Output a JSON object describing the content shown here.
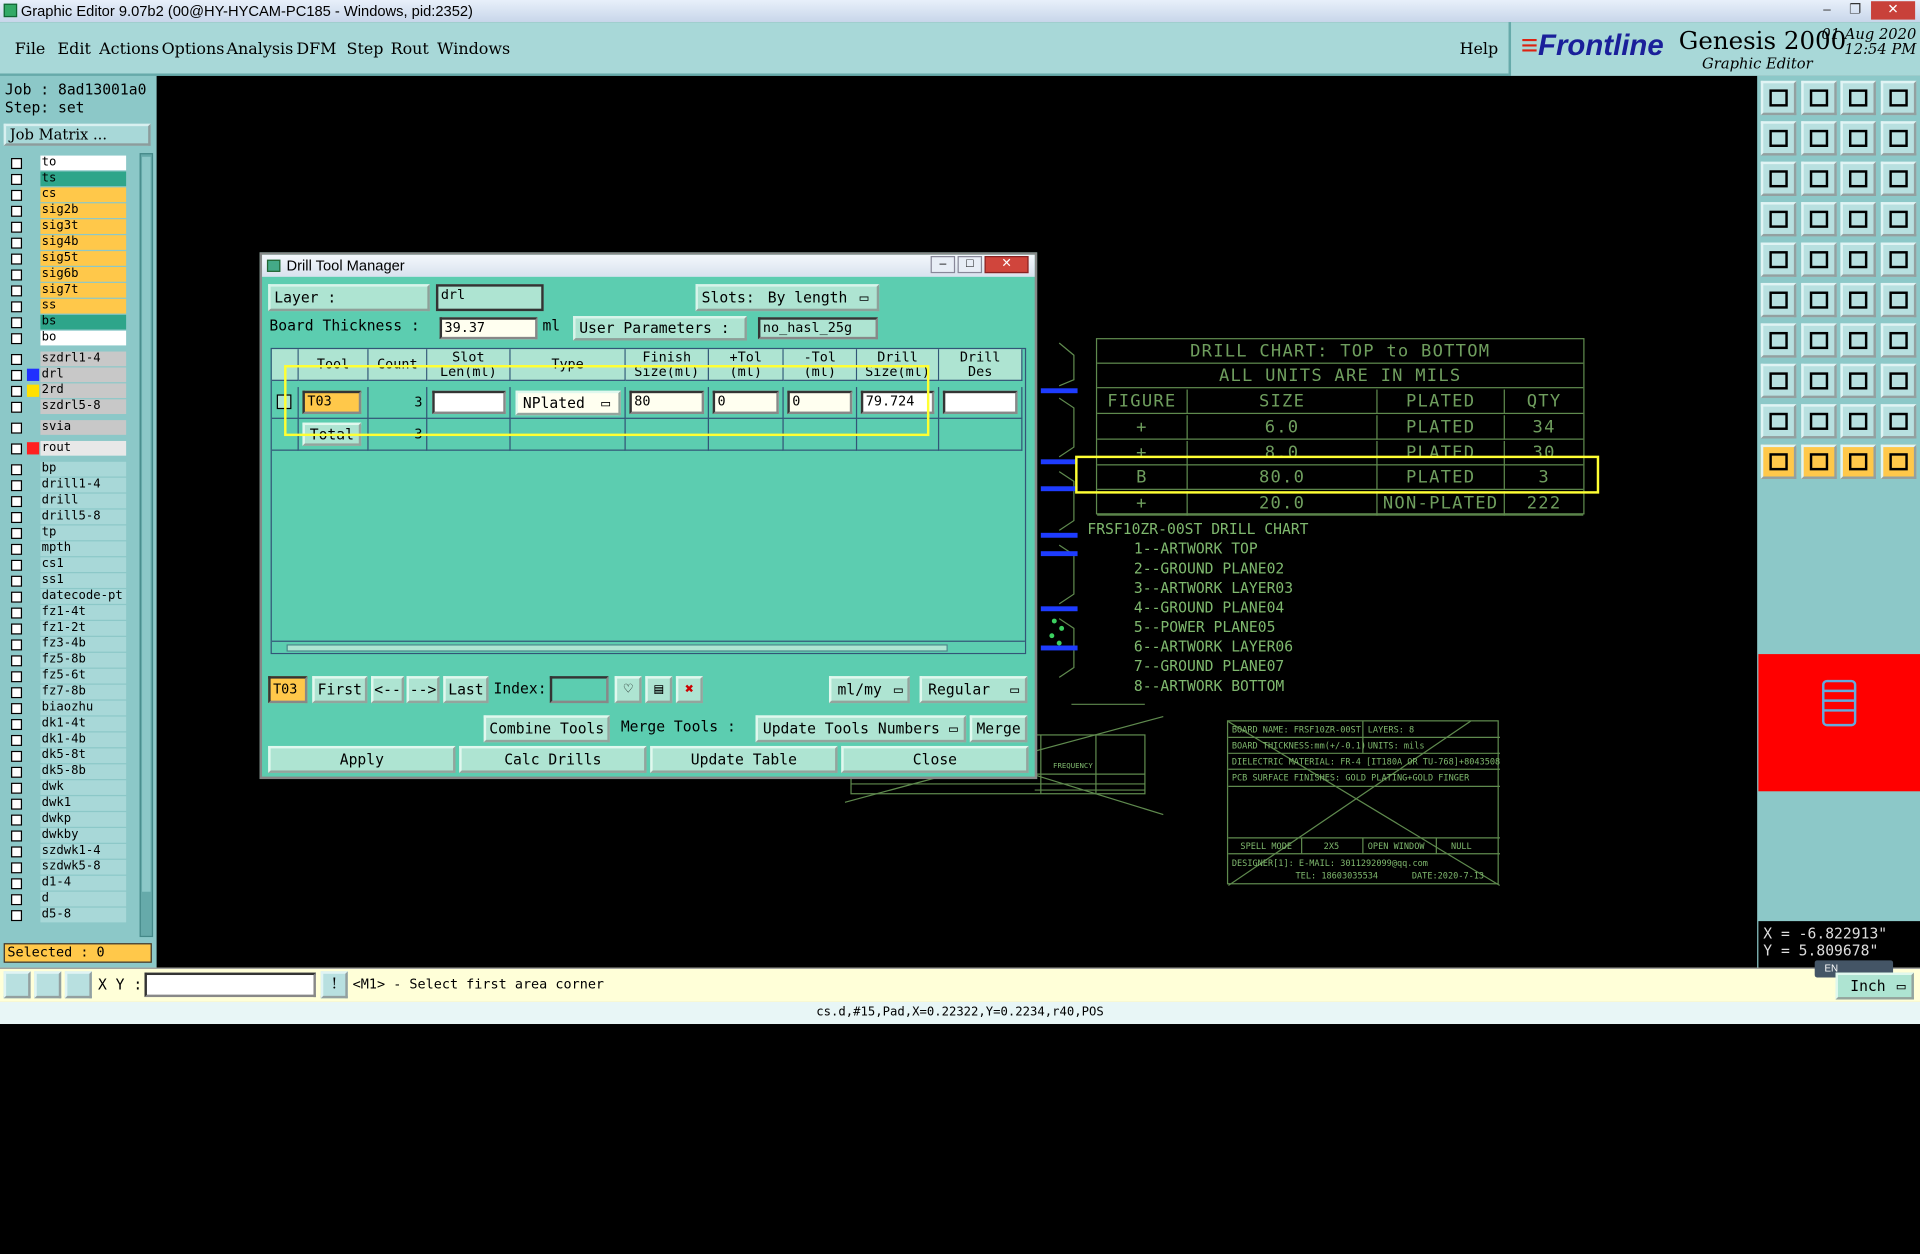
{
  "window": {
    "title": "Graphic Editor 9.07b2 (00@HY-HYCAM-PC185 - Windows, pid:2352)",
    "min": "–",
    "max": "❐",
    "close": "✕"
  },
  "menu": [
    "File",
    "Edit",
    "Actions",
    "Options",
    "Analysis",
    "DFM",
    "Step",
    "Rout",
    "Windows"
  ],
  "menu_help": "Help",
  "brand": {
    "logo_main": "Frontline",
    "genesis": "Genesis 2000",
    "subtitle": "Graphic Editor",
    "date": "01 Aug 2020",
    "time": "12:54 PM"
  },
  "job": {
    "job": "Job : 8ad13001a0",
    "step": "Step: set",
    "matrix_btn": "Job Matrix ..."
  },
  "layers": [
    {
      "n": "to",
      "bg": "#ffffff",
      "sw": ""
    },
    {
      "n": "ts",
      "bg": "#2ea58a",
      "sw": ""
    },
    {
      "n": "cs",
      "bg": "#ffc84a",
      "sw": ""
    },
    {
      "n": "sig2b",
      "bg": "#ffc84a",
      "sw": ""
    },
    {
      "n": "sig3t",
      "bg": "#ffc84a",
      "sw": ""
    },
    {
      "n": "sig4b",
      "bg": "#ffc84a",
      "sw": ""
    },
    {
      "n": "sig5t",
      "bg": "#ffc84a",
      "sw": ""
    },
    {
      "n": "sig6b",
      "bg": "#ffc84a",
      "sw": ""
    },
    {
      "n": "sig7t",
      "bg": "#ffc84a",
      "sw": ""
    },
    {
      "n": "ss",
      "bg": "#ffc84a",
      "sw": ""
    },
    {
      "n": "bs",
      "bg": "#2ea58a",
      "sw": ""
    },
    {
      "n": "bo",
      "bg": "#ffffff",
      "sw": ""
    },
    {
      "n": "szdrl1-4",
      "bg": "#c8c8c8",
      "sw": ""
    },
    {
      "n": "drl",
      "bg": "#c8c8c8",
      "sw": "#2030ff"
    },
    {
      "n": "2rd",
      "bg": "#c8c8c8",
      "sw": "#ffe000"
    },
    {
      "n": "szdrl5-8",
      "bg": "#c8c8c8",
      "sw": ""
    },
    {
      "n": "svia",
      "bg": "#c8c8c8",
      "sw": ""
    },
    {
      "n": "rout",
      "bg": "#e8e8e8",
      "sw": "#ff2020"
    },
    {
      "n": "bp",
      "bg": "#a8d8d8",
      "sw": ""
    },
    {
      "n": "drill1-4",
      "bg": "#a8d8d8",
      "sw": ""
    },
    {
      "n": "drill",
      "bg": "#a8d8d8",
      "sw": ""
    },
    {
      "n": "drill5-8",
      "bg": "#a8d8d8",
      "sw": ""
    },
    {
      "n": "tp",
      "bg": "#a8d8d8",
      "sw": ""
    },
    {
      "n": "mpth",
      "bg": "#a8d8d8",
      "sw": ""
    },
    {
      "n": "cs1",
      "bg": "#a8d8d8",
      "sw": ""
    },
    {
      "n": "ss1",
      "bg": "#a8d8d8",
      "sw": ""
    },
    {
      "n": "datecode-pt",
      "bg": "#a8d8d8",
      "sw": ""
    },
    {
      "n": "fz1-4t",
      "bg": "#a8d8d8",
      "sw": ""
    },
    {
      "n": "fz1-2t",
      "bg": "#a8d8d8",
      "sw": ""
    },
    {
      "n": "fz3-4b",
      "bg": "#a8d8d8",
      "sw": ""
    },
    {
      "n": "fz5-8b",
      "bg": "#a8d8d8",
      "sw": ""
    },
    {
      "n": "fz5-6t",
      "bg": "#a8d8d8",
      "sw": ""
    },
    {
      "n": "fz7-8b",
      "bg": "#a8d8d8",
      "sw": ""
    },
    {
      "n": "biaozhu",
      "bg": "#a8d8d8",
      "sw": ""
    },
    {
      "n": "dk1-4t",
      "bg": "#a8d8d8",
      "sw": ""
    },
    {
      "n": "dk1-4b",
      "bg": "#a8d8d8",
      "sw": ""
    },
    {
      "n": "dk5-8t",
      "bg": "#a8d8d8",
      "sw": ""
    },
    {
      "n": "dk5-8b",
      "bg": "#a8d8d8",
      "sw": ""
    },
    {
      "n": "dwk",
      "bg": "#a8d8d8",
      "sw": ""
    },
    {
      "n": "dwk1",
      "bg": "#a8d8d8",
      "sw": ""
    },
    {
      "n": "dwkp",
      "bg": "#a8d8d8",
      "sw": ""
    },
    {
      "n": "dwkby",
      "bg": "#a8d8d8",
      "sw": ""
    },
    {
      "n": "szdwk1-4",
      "bg": "#a8d8d8",
      "sw": ""
    },
    {
      "n": "szdwk5-8",
      "bg": "#a8d8d8",
      "sw": ""
    },
    {
      "n": "d1-4",
      "bg": "#a8d8d8",
      "sw": ""
    },
    {
      "n": "d",
      "bg": "#a8d8d8",
      "sw": ""
    },
    {
      "n": "d5-8",
      "bg": "#a8d8d8",
      "sw": ""
    }
  ],
  "selected": "Selected : 0",
  "dialog": {
    "title": "Drill Tool Manager",
    "layer_label": "Layer               :",
    "layer_value": "drl",
    "slots_label": "Slots:",
    "slots_value": "By length",
    "thickness_label": "Board Thickness :",
    "thickness_value": "39.37",
    "thickness_unit": "ml",
    "userparams_label": "User Parameters :",
    "userparams_value": "no_hasl_25g",
    "headers": [
      "Tool",
      "Count",
      "Slot\nLen(ml)",
      "Type",
      "Finish\nSize(ml)",
      "+Tol\n(ml)",
      "-Tol\n(ml)",
      "Drill\nSize(ml)",
      "Drill\nDes"
    ],
    "row": {
      "tool": "T03",
      "count": "3",
      "slot_len": "",
      "type": "NPlated",
      "finish": "80",
      "ptol": "0",
      "ntol": "0",
      "drill": "79.724",
      "des": ""
    },
    "total_label": "Total",
    "total_count": "3",
    "nav": {
      "current": "T03",
      "first": "First",
      "prev": "<--",
      "next": "-->",
      "last": "Last",
      "index_label": "Index:",
      "index_value": "",
      "unit": "ml/my",
      "mode": "Regular"
    },
    "combine": "Combine Tools",
    "merge_label": "Merge Tools :",
    "update_numbers": "Update Tools Numbers",
    "merge": "Merge",
    "apply": "Apply",
    "calc": "Calc Drills",
    "update_table": "Update Table",
    "close": "Close"
  },
  "drill_chart": {
    "title": "DRILL CHART: TOP to BOTTOM",
    "subtitle": "ALL UNITS ARE IN MILS",
    "headers": [
      "FIGURE",
      "SIZE",
      "PLATED",
      "QTY"
    ],
    "rows": [
      {
        "fig": "+",
        "size": "6.0",
        "plated": "PLATED",
        "qty": "34"
      },
      {
        "fig": "+",
        "size": "8.0",
        "plated": "PLATED",
        "qty": "30"
      },
      {
        "fig": "B",
        "size": "80.0",
        "plated": "PLATED",
        "qty": "3"
      },
      {
        "fig": "+",
        "size": "20.0",
        "plated": "NON-PLATED",
        "qty": "222"
      }
    ]
  },
  "art": {
    "title": "FRSF10ZR-00ST DRILL CHART",
    "items": [
      "1--ARTWORK TOP",
      "2--GROUND PLANE02",
      "3--ARTWORK LAYER03",
      "4--GROUND PLANE04",
      "5--POWER PLANE05",
      "6--ARTWORK LAYER06",
      "7--GROUND PLANE07",
      "8--ARTWORK BOTTOM"
    ]
  },
  "title_block": {
    "board": "BOARD NAME: FRSF10ZR-00ST",
    "layers": "LAYERS: 8",
    "thickness": "BOARD THICKNESS:mm(+/-0.1)",
    "units": "UNITS: mils",
    "dielectric": "DIELECTRIC MATERIAL: FR-4 [IT180A OR TU-768]+8043508",
    "finish": "PCB SURFACE FINISHES: GOLD PLATING+GOLD FINGER",
    "spell": "SPELL MODE",
    "spell_v": "2X5",
    "open": "OPEN WINDOW",
    "open_v": "NULL",
    "designer": "DESIGNER[1]: E-MAIL: 3011292099@qq.com",
    "tel": "TEL:  18603035534",
    "date": "DATE:2020-7-13"
  },
  "coords": {
    "x": "X = -6.822913\"",
    "y": "Y = 5.809678\""
  },
  "bottom": {
    "xy_label": "X Y :",
    "xy_value": "",
    "prompt": "<M1> - Select first area corner",
    "ime": "EN",
    "units": "Inch"
  },
  "status": "cs.d,#15,Pad,X=0.22322,Y=0.2234,r40,POS",
  "colors": {
    "panel": "#8cc8c8",
    "dialog": "#5ccdb0",
    "highlight": "#ffff33",
    "cad": "#7fb86e"
  }
}
